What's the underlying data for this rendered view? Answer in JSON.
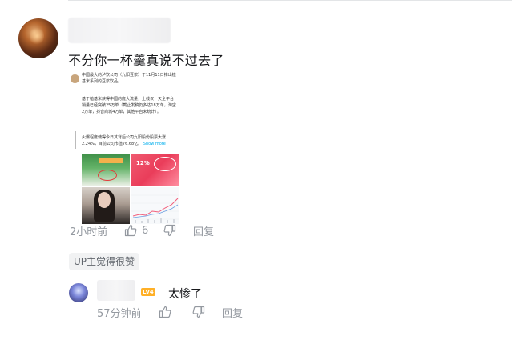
{
  "comment": {
    "text": "不分你一杯羹真说不过去了",
    "time": "2小时前",
    "likes": "6",
    "reply_label": "回复",
    "up_badge": "UP主觉得很赞"
  },
  "attached_image": {
    "para1": "中国最大的泸饮公司（九阳豆浆）于11月11日推出植基米系列的豆浆饮品。",
    "para2": "基于植基米获得中国的庞大流量，上线仅一天全平台销量已经突破25万单（截止发稿仍多达18万单，淘宝2万单，抖音商城4万单，其他平台未统计）。",
    "para3": "火爆程度使得今日其背后公司九阳股份股票大涨2.24%，目前公司市值76.68亿。",
    "show_more": "Show more",
    "cell_pct": "12%"
  },
  "reply": {
    "level_badge": "LV4",
    "text": "太惨了",
    "time": "57分钟前",
    "reply_label": "回复"
  },
  "icons": [
    "thumbs-up-icon",
    "thumbs-down-icon"
  ]
}
